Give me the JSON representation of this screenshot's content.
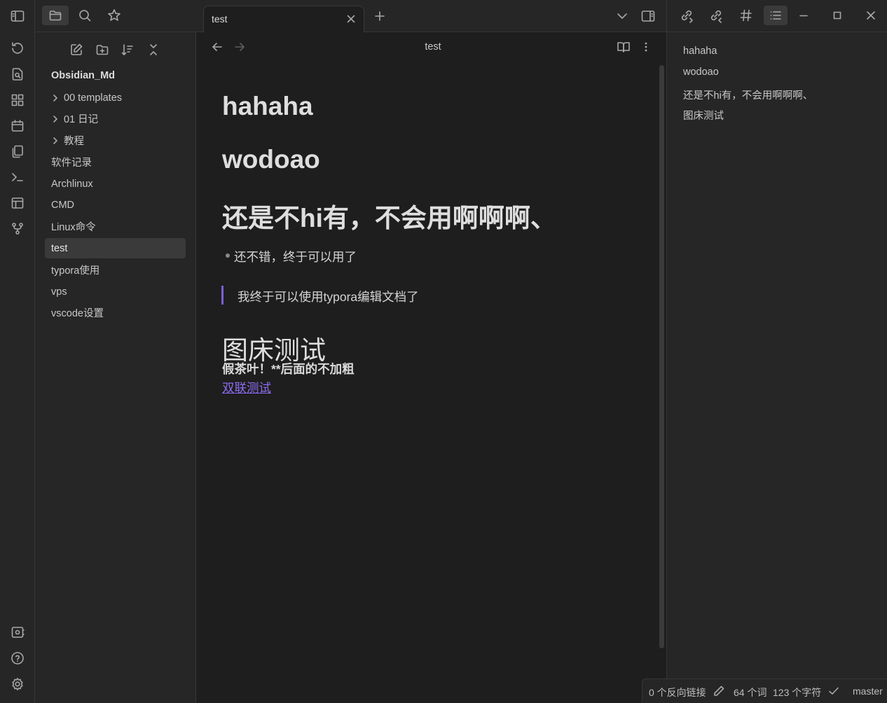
{
  "sidebar_toolbar": {
    "icons": [
      "sidebar-toggle-icon",
      "folder-icon",
      "search-icon",
      "star-icon"
    ],
    "active": "folder-icon"
  },
  "ribbon": {
    "top_icons": [
      "history-icon",
      "file-search-icon",
      "blocks-icon",
      "calendar-icon",
      "copy-icon",
      "terminal-icon",
      "layout-icon",
      "git-graph-icon"
    ],
    "bottom_icons": [
      "vault-switcher-icon",
      "help-icon",
      "settings-icon"
    ]
  },
  "explorer": {
    "nav_icons": [
      "new-note-icon",
      "new-folder-icon",
      "sort-icon",
      "collapse-all-icon"
    ],
    "vault_name": "Obsidian_Md",
    "items": [
      {
        "label": "00 templates",
        "type": "folder"
      },
      {
        "label": "01 日记",
        "type": "folder"
      },
      {
        "label": "教程",
        "type": "folder"
      },
      {
        "label": "软件记录",
        "type": "file"
      },
      {
        "label": "Archlinux",
        "type": "file"
      },
      {
        "label": "CMD",
        "type": "file"
      },
      {
        "label": "Linux命令",
        "type": "file"
      },
      {
        "label": "test",
        "type": "file",
        "active": true
      },
      {
        "label": "typora使用",
        "type": "file"
      },
      {
        "label": "vps",
        "type": "file"
      },
      {
        "label": "vscode设置",
        "type": "file"
      }
    ]
  },
  "tabs": {
    "active_tab": "test",
    "right_icons": [
      "chevron-down-icon",
      "sidebar-right-icon"
    ]
  },
  "editor": {
    "view_title": "test",
    "heading1": "hahaha",
    "heading2": "wodoao",
    "heading3": "还是不hi有，不会用啊啊啊、",
    "bullet": "还不错，终于可以用了",
    "blockquote": "我终于可以使用typora编辑文档了",
    "heading4": "图床测试",
    "bold_line": "假茶叶！**后面的不加粗",
    "link": "双联测试",
    "link_color": "#8a6cf0",
    "quote_bar_color": "#7b5fd6"
  },
  "right_toolbar": {
    "icons": [
      "backlinks-icon",
      "outgoing-links-icon",
      "tags-icon",
      "outline-icon",
      "minimize-icon",
      "maximize-icon",
      "close-icon"
    ],
    "active": "outline-icon"
  },
  "outline": [
    "hahaha",
    "wodoao",
    "还是不hi有，不会用啊啊啊、",
    "图床测试"
  ],
  "status": {
    "backlinks": "0 个反向链接",
    "words": "64 个词",
    "chars": "123 个字符",
    "branch": "master"
  }
}
